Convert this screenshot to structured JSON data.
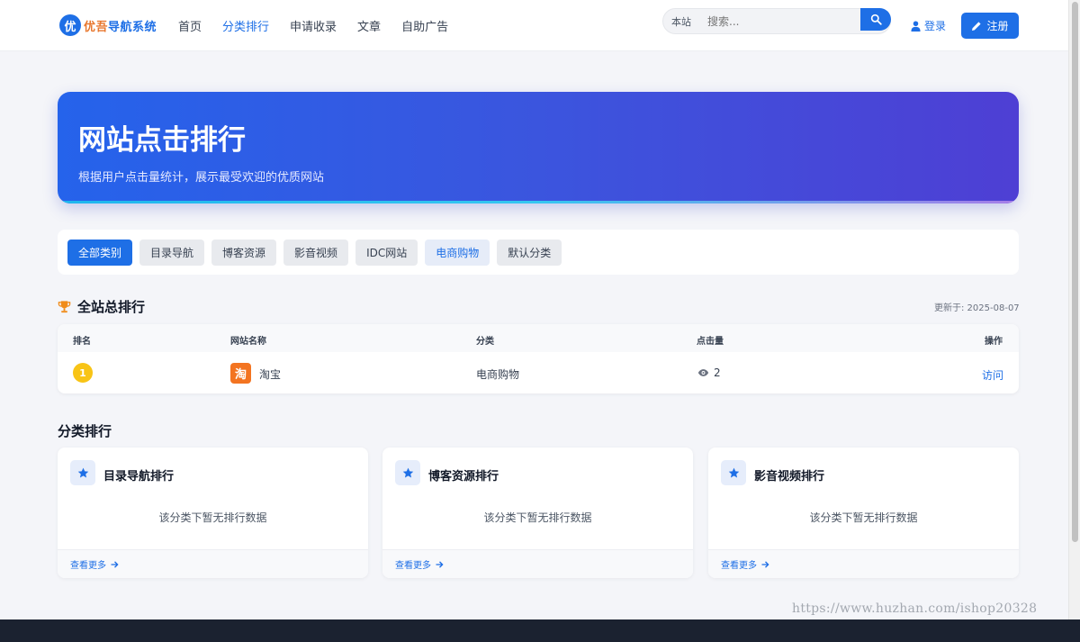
{
  "header": {
    "logo_badge": "优",
    "logo_text_a": "优吾",
    "logo_text_b": "导航系统",
    "nav": [
      "首页",
      "分类排行",
      "申请收录",
      "文章",
      "自助广告"
    ],
    "nav_active_index": 1,
    "search_scope": "本站",
    "search_placeholder": "搜索...",
    "login_label": "登录",
    "register_label": "注册"
  },
  "banner": {
    "title": "网站点击排行",
    "subtitle": "根据用户点击量统计，展示最受欢迎的优质网站"
  },
  "filter": {
    "chips": [
      "全部类别",
      "目录导航",
      "博客资源",
      "影音视频",
      "IDC网站",
      "电商购物",
      "默认分类"
    ],
    "active_index": 0,
    "highlight_index": 5
  },
  "overall": {
    "title": "全站总排行",
    "updated": "更新于: 2025-08-07",
    "columns": [
      "排名",
      "网站名称",
      "分类",
      "点击量",
      "操作"
    ],
    "rows": [
      {
        "rank": "1",
        "icon_text": "淘",
        "name": "淘宝",
        "category": "电商购物",
        "clicks": "2",
        "action": "访问"
      }
    ]
  },
  "category_ranking": {
    "title": "分类排行",
    "cards": [
      {
        "title": "目录导航排行",
        "empty": "该分类下暂无排行数据",
        "more": "查看更多"
      },
      {
        "title": "博客资源排行",
        "empty": "该分类下暂无排行数据",
        "more": "查看更多"
      },
      {
        "title": "影音视频排行",
        "empty": "该分类下暂无排行数据",
        "more": "查看更多"
      }
    ]
  },
  "watermark": "https://www.huzhan.com/ishop20328",
  "colors": {
    "accent": "#1e6fe6",
    "gold": "#f8c416",
    "trophy": "#f08c1a",
    "footer": "#1b2230"
  },
  "icons": [
    "search-icon",
    "user-icon",
    "pencil-icon",
    "trophy-icon",
    "eye-icon",
    "star-icon",
    "arrow-right-icon"
  ]
}
